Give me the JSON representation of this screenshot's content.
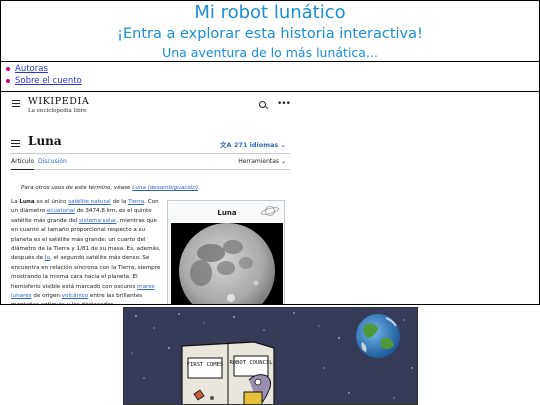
{
  "header": {
    "title": "Mi robot lunático",
    "subtitle": "¡Entra a explorar esta historia interactiva!",
    "tagline": "Una aventura de lo más lunática..."
  },
  "nav": {
    "items": [
      {
        "label": "Autoras"
      },
      {
        "label": "Sobre el cuento"
      }
    ]
  },
  "wiki": {
    "logo_name": "WIKIPEDIA",
    "logo_tagline": "La enciclopedia libre",
    "page_title": "Luna",
    "languages": "271 idiomas",
    "tab_article": "Artículo",
    "tab_discussion": "Discusión",
    "tools": "Herramientas",
    "hatnote_prefix": "Para otros usos de este término, véase ",
    "hatnote_link": "Luna (desambiguación)",
    "hatnote_suffix": ".",
    "infobox_title": "Luna",
    "body": {
      "p1": "La ",
      "bold": "Luna",
      "p2": " es el único ",
      "l1": "satélite natural",
      "p3": " de la ",
      "l2": "Tierra",
      "p4": ". Con un diámetro ",
      "l3": "ecuatorial",
      "p5": " de 3474,8 km, es el quinto satélite más grande del ",
      "l4": "sistema solar",
      "p6": ", mientras que en cuanto al tamaño proporcional respecto a su planeta es el satélite más grande: un cuarto del diámetro de la Tierra y 1/81 de su masa. Es, además, después de ",
      "l5": "Ío",
      "p7": ", el segundo satélite más denso. Se encuentra en relación síncrona con la Tierra, siempre mostrando la misma cara hacia el planeta. El hemisferio visible está marcado con oscuros ",
      "l6": "mares lunares",
      "p8": " de origen ",
      "l7": "volcánico",
      "p9": " entre las brillantes montañas antiguas y los destacados"
    }
  },
  "illustration": {
    "sign_left": "FIRST COMES",
    "sign_right": "ROBOT COUNCIL"
  },
  "colors": {
    "header_text": "#1a8fd6",
    "nav_link": "#2a35d8",
    "nav_bullet": "#c8007a",
    "wiki_link": "#3366cc"
  }
}
